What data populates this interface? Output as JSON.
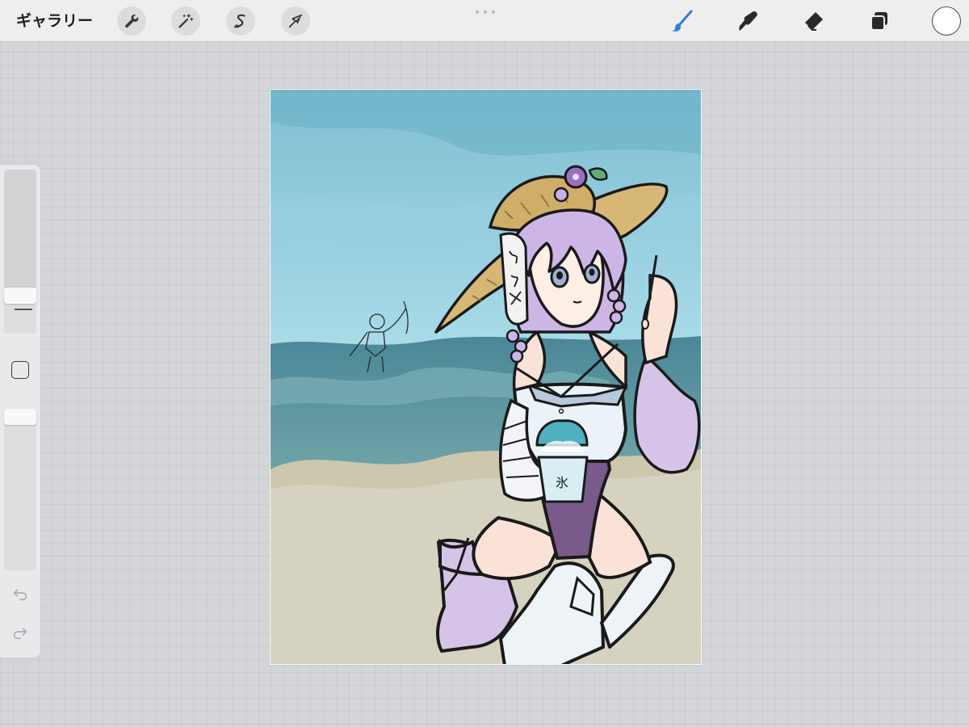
{
  "toolbar": {
    "gallery_label": "ギャラリー",
    "left_tools": [
      {
        "name": "actions",
        "icon": "wrench-icon"
      },
      {
        "name": "adjustments",
        "icon": "magic-wand-icon"
      },
      {
        "name": "selection",
        "icon": "selection-s-icon"
      },
      {
        "name": "transform",
        "icon": "arrow-cursor-icon"
      }
    ],
    "right_tools": [
      {
        "name": "brush",
        "icon": "brush-icon",
        "active": true
      },
      {
        "name": "smudge",
        "icon": "smudge-finger-icon",
        "active": false
      },
      {
        "name": "eraser",
        "icon": "eraser-icon",
        "active": false
      },
      {
        "name": "layers",
        "icon": "layers-icon",
        "active": false
      }
    ],
    "current_color": "#ffffff",
    "active_tool_color": "#2f7fd8"
  },
  "sidebar": {
    "brush_size_level": 0.2,
    "opacity_level": 1.0,
    "modify_button_icon": "square-outline-icon",
    "undo_icon": "undo-arrow-icon",
    "redo_icon": "redo-arrow-icon"
  },
  "artwork": {
    "colors": {
      "sky": "#8fc9d9",
      "sea": "#4f8f9f",
      "sand": "#d6d2c0",
      "hair": "#cdb6e6",
      "hat": "#d6b775",
      "swimsuit": "#7a5a8a",
      "skin": "#f8ddd0",
      "boots": "#e6eef6"
    },
    "cup_label": "氷"
  }
}
